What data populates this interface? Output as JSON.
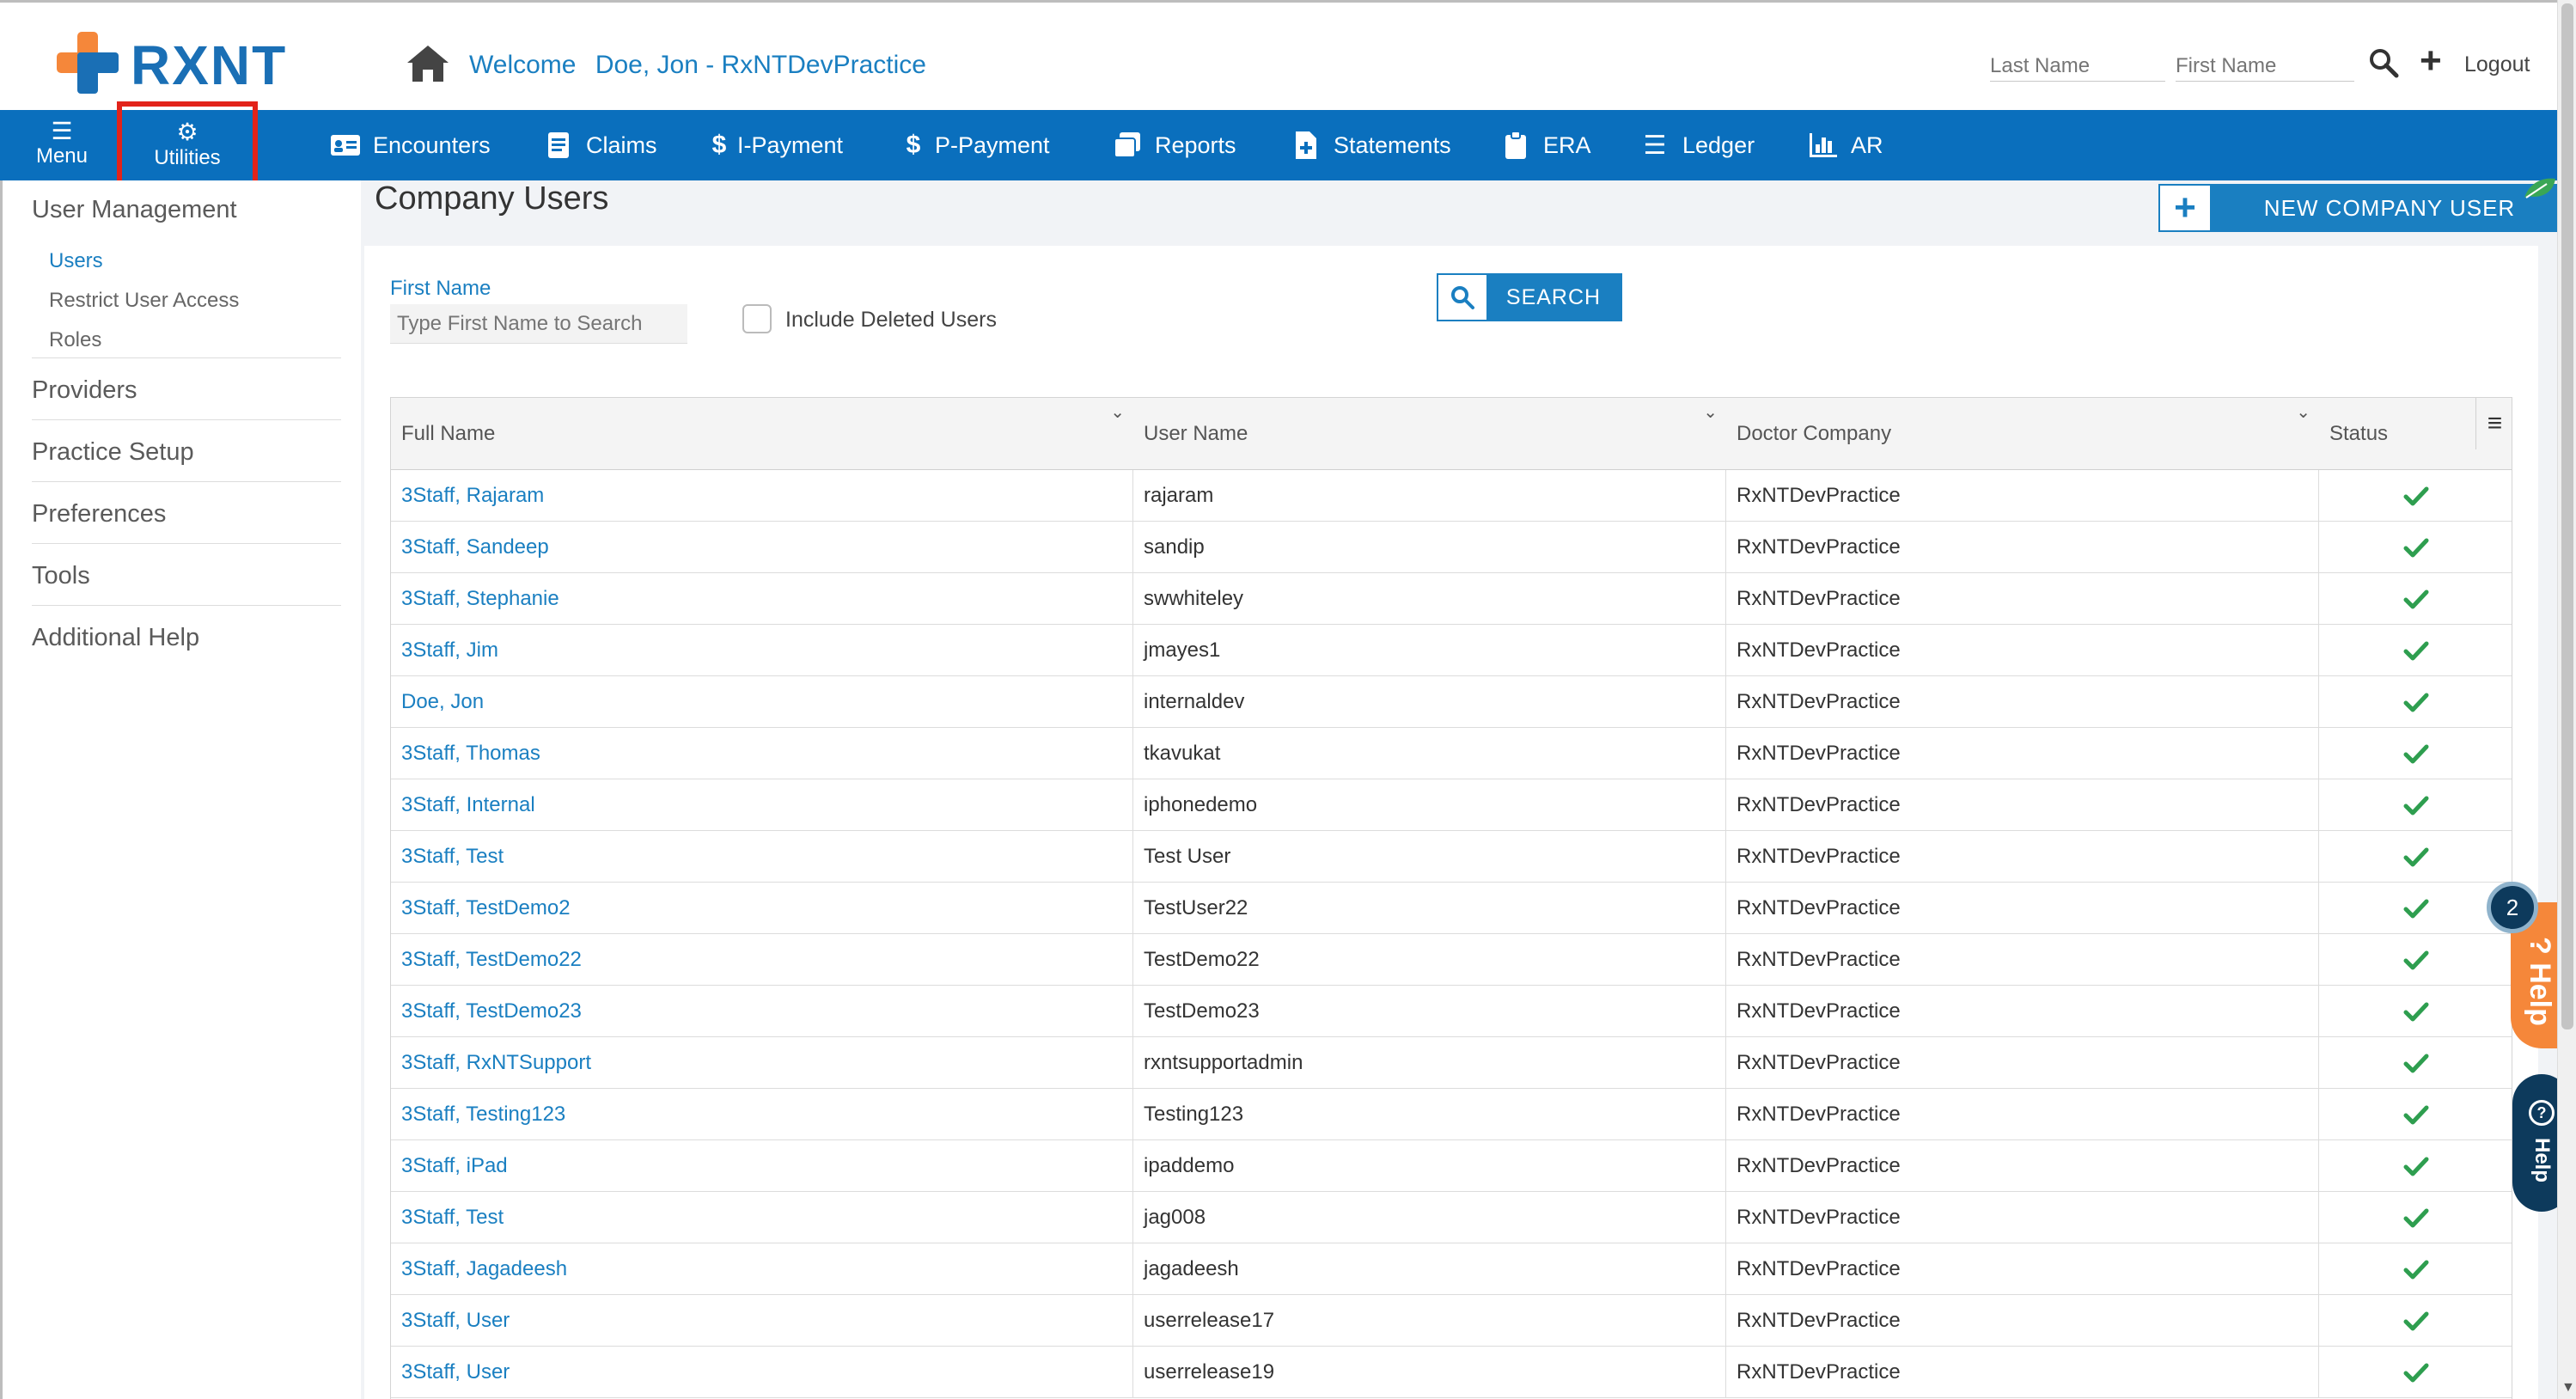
{
  "header": {
    "logo_text": "RXNT",
    "welcome_label": "Welcome",
    "user_label": "Doe, Jon - RxNTDevPractice",
    "last_name_placeholder": "Last Name",
    "first_name_placeholder": "First Name",
    "logout_label": "Logout"
  },
  "nav": {
    "menu_label": "Menu",
    "utilities_label": "Utilities",
    "items": [
      {
        "label": "Encounters",
        "icon": "id-card-icon"
      },
      {
        "label": "Claims",
        "icon": "document-icon"
      },
      {
        "label": "I-Payment",
        "icon": "dollar-icon"
      },
      {
        "label": "P-Payment",
        "icon": "dollar-icon"
      },
      {
        "label": "Reports",
        "icon": "copy-icon"
      },
      {
        "label": "Statements",
        "icon": "file-plus-icon"
      },
      {
        "label": "ERA",
        "icon": "clipboard-icon"
      },
      {
        "label": "Ledger",
        "icon": "list-icon"
      },
      {
        "label": "AR",
        "icon": "bar-chart-icon"
      }
    ]
  },
  "sidebar": {
    "user_management": "User Management",
    "users": "Users",
    "restrict_user_access": "Restrict User Access",
    "roles": "Roles",
    "providers": "Providers",
    "practice_setup": "Practice Setup",
    "preferences": "Preferences",
    "tools": "Tools",
    "additional_help": "Additional Help"
  },
  "main": {
    "title": "Company Users",
    "new_user_button": "NEW COMPANY USER",
    "search": {
      "first_name_label": "First Name",
      "first_name_placeholder": "Type First Name to Search",
      "include_deleted_label": "Include Deleted Users",
      "button_label": "SEARCH"
    },
    "table": {
      "columns": [
        "Full Name",
        "User Name",
        "Doctor Company",
        "Status"
      ],
      "rows": [
        {
          "full_name": "3Staff, Rajaram",
          "user_name": "rajaram",
          "company": "RxNTDevPractice"
        },
        {
          "full_name": "3Staff, Sandeep",
          "user_name": "sandip",
          "company": "RxNTDevPractice"
        },
        {
          "full_name": "3Staff, Stephanie",
          "user_name": "swwhiteley",
          "company": "RxNTDevPractice"
        },
        {
          "full_name": "3Staff, Jim",
          "user_name": "jmayes1",
          "company": "RxNTDevPractice"
        },
        {
          "full_name": "Doe, Jon",
          "user_name": "internaldev",
          "company": "RxNTDevPractice"
        },
        {
          "full_name": "3Staff, Thomas",
          "user_name": "tkavukat",
          "company": "RxNTDevPractice"
        },
        {
          "full_name": "3Staff, Internal",
          "user_name": "iphonedemo",
          "company": "RxNTDevPractice"
        },
        {
          "full_name": "3Staff, Test",
          "user_name": "Test User",
          "company": "RxNTDevPractice"
        },
        {
          "full_name": "3Staff, TestDemo2",
          "user_name": "TestUser22",
          "company": "RxNTDevPractice"
        },
        {
          "full_name": "3Staff, TestDemo22",
          "user_name": "TestDemo22",
          "company": "RxNTDevPractice"
        },
        {
          "full_name": "3Staff, TestDemo23",
          "user_name": "TestDemo23",
          "company": "RxNTDevPractice"
        },
        {
          "full_name": "3Staff, RxNTSupport",
          "user_name": "rxntsupportadmin",
          "company": "RxNTDevPractice"
        },
        {
          "full_name": "3Staff, Testing123",
          "user_name": "Testing123",
          "company": "RxNTDevPractice"
        },
        {
          "full_name": "3Staff, iPad",
          "user_name": "ipaddemo",
          "company": "RxNTDevPractice"
        },
        {
          "full_name": "3Staff, Test",
          "user_name": "jag008",
          "company": "RxNTDevPractice"
        },
        {
          "full_name": "3Staff, Jagadeesh",
          "user_name": "jagadeesh",
          "company": "RxNTDevPractice"
        },
        {
          "full_name": "3Staff, User",
          "user_name": "userrelease17",
          "company": "RxNTDevPractice"
        },
        {
          "full_name": "3Staff, User",
          "user_name": "userrelease19",
          "company": "RxNTDevPractice"
        }
      ]
    }
  },
  "help_widget": {
    "badge_count": "2",
    "orange_label": "? Help",
    "dark_label": "Help"
  },
  "colors": {
    "brand_blue": "#0a6fbd",
    "link_blue": "#1a7fc1",
    "logo_orange": "#f5873a",
    "status_green": "#2e9e4f",
    "highlight_red": "#e2231a"
  }
}
